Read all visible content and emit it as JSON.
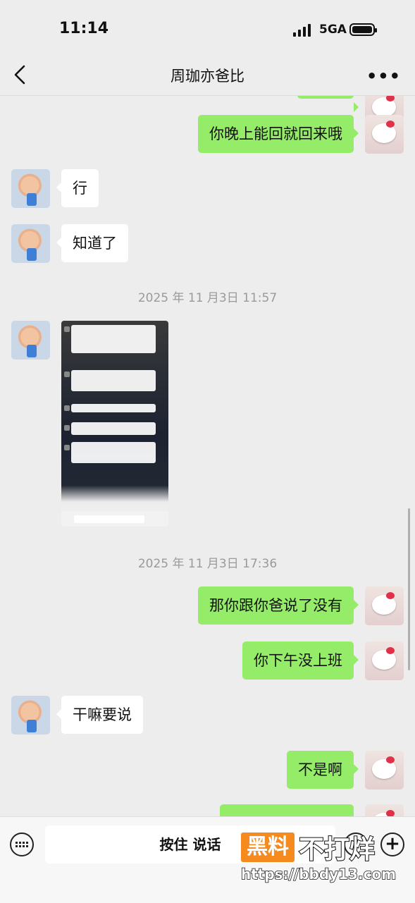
{
  "status_bar": {
    "time": "11:14",
    "network": "5GA"
  },
  "header": {
    "title": "周珈亦爸比",
    "more": "•••"
  },
  "messages": [
    {
      "side": "right",
      "text": "你晚上能回就回来哦"
    },
    {
      "side": "left",
      "text": "行"
    },
    {
      "side": "left",
      "text": "知道了"
    },
    {
      "type": "timestamp",
      "text": "2025 年 11 月3日 11:57"
    },
    {
      "side": "left",
      "type": "image"
    },
    {
      "type": "timestamp",
      "text": "2025 年 11 月3日 17:36"
    },
    {
      "side": "right",
      "text": "那你跟你爸说了没有"
    },
    {
      "side": "right",
      "text": "你下午没上班"
    },
    {
      "side": "left",
      "text": "干嘛要说"
    },
    {
      "side": "right",
      "text": "不是啊"
    }
  ],
  "input_bar": {
    "hold_to_talk": "按住 说话"
  },
  "watermark": {
    "brand": "黑料",
    "text": "不打烊",
    "url": "https://bbdy13.com"
  }
}
